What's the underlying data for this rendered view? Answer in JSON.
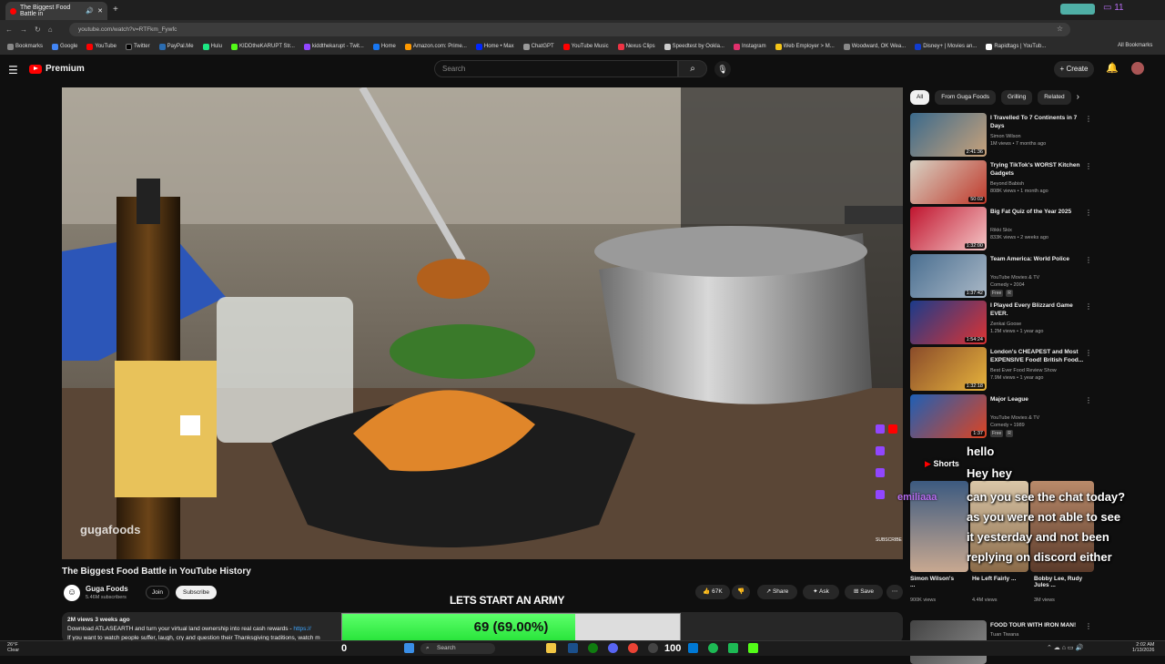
{
  "browser": {
    "tab_title": "The Biggest Food Battle in",
    "url": "youtube.com/watch?v=RTFkm_Fywfc",
    "bookmarks": [
      "Bookmarks",
      "Google",
      "YouTube",
      "Twitter",
      "PayPal.Me",
      "Hulu",
      "KIDDtheKARUPT Str...",
      "kiddthekarupt - Twit...",
      "Home",
      "Amazon.com: Prime...",
      "Home • Max",
      "ChatGPT",
      "YouTube Music",
      "Nexus Clips",
      "Speedtest by Ookla...",
      "Instagram",
      "Web Employer > M...",
      "Woodward, OK Wea...",
      "Disney+ | Movies an...",
      "Rapidtags | YouTub..."
    ],
    "all_bookmarks": "All Bookmarks"
  },
  "header": {
    "logo_label": "Premium",
    "search_placeholder": "Search",
    "create_label": "Create"
  },
  "video": {
    "title": "The Biggest Food Battle in YouTube History",
    "channel": "Guga Foods",
    "subscribers": "5.46M subscribers",
    "join": "Join",
    "subscribe": "Subscribe",
    "likes": "67K",
    "share": "Share",
    "ask": "Ask",
    "save": "Save",
    "watermark": "gugafoods",
    "subscribe_watermark": "SUBSCRIBE",
    "desc_meta": "2M views  3 weeks ago",
    "desc_line1": "Download ATLASEARTH and turn your virtual land ownership into real cash rewards - ",
    "desc_link": "https://",
    "desc_line2": "If you want to watch people suffer, laugh, cry and question their Thanksgiving traditions, watch m"
  },
  "chips": [
    "All",
    "From Guga Foods",
    "Grilling",
    "Related"
  ],
  "recommendations": [
    {
      "title": "I Travelled To 7 Continents in 7 Days",
      "channel": "Simon Wilson",
      "meta": "1M views • 7 months ago",
      "duration": "2:41:36",
      "colors": [
        "#3b6a8c",
        "#c9a27a"
      ]
    },
    {
      "title": "Trying TikTok's WORST Kitchen Gadgets",
      "channel": "Beyond Babish",
      "meta": "808K views • 1 month ago",
      "duration": "50:02",
      "colors": [
        "#d7d2c4",
        "#c0392b"
      ]
    },
    {
      "title": "Big Fat Quiz of the Year 2025",
      "channel": "Rikki Skix",
      "meta": "833K views • 2 weeks ago",
      "duration": "1:32:00",
      "colors": [
        "#c0152f",
        "#f4c6c6"
      ]
    },
    {
      "title": "Team America: World Police",
      "channel": "YouTube Movies & TV",
      "meta": "Comedy • 2004",
      "badges": [
        "Free",
        "R"
      ],
      "duration": "1:37:42",
      "colors": [
        "#4a6f91",
        "#aab8c6"
      ]
    },
    {
      "title": "I Played Every Blizzard Game EVER.",
      "channel": "Zenkai Goose",
      "meta": "1.2M views • 1 year ago",
      "duration": "1:54:24",
      "colors": [
        "#1b3b8a",
        "#d33"
      ]
    },
    {
      "title": "London's CHEAPEST and Most EXPENSIVE Food! British Food...",
      "channel": "Best Ever Food Review Show",
      "meta": "7.9M views • 1 year ago",
      "duration": "1:32:18",
      "colors": [
        "#8a4b2a",
        "#e6b33c"
      ]
    },
    {
      "title": "Major League",
      "channel": "YouTube Movies & TV",
      "meta": "Comedy • 1989",
      "badges": [
        "Free",
        "R"
      ],
      "duration": "1:37",
      "colors": [
        "#1e5fb5",
        "#d42"
      ]
    },
    {
      "title": "FOOD TOUR WITH IRON MAN!",
      "channel": "Tuan Tiwana",
      "meta": "",
      "duration": "",
      "colors": [
        "#444",
        "#888"
      ]
    }
  ],
  "shorts": {
    "label": "Shorts",
    "items": [
      {
        "title": "Simon Wilson's ...",
        "meta": "900K views"
      },
      {
        "title": "He Left Fairly ...",
        "meta": "4.4M views"
      },
      {
        "title": "Bobby Lee, Rudy Jules ...",
        "meta": "3M views"
      }
    ]
  },
  "stream_overlay": {
    "chat_user": "emiliaaa",
    "chat_messages": [
      "hello",
      "Hey hey",
      "can you see the chat today?",
      "as you were not able to see",
      "it yesterday and not been",
      "replying on discord either"
    ],
    "goal_banner": "LETS START AN ARMY",
    "goal_text": "69 (69.00%)",
    "goal_fraction": 0.69,
    "counter_left": "0",
    "counter_right": "100"
  },
  "taskbar": {
    "weather_temp": "26°F",
    "weather_desc": "Clear",
    "search": "Search",
    "time": "2:02 AM",
    "date": "1/13/2026"
  },
  "colors": {
    "accent": "#ff0000",
    "goal_green": "#3ef04e",
    "link": "#3ea6ff"
  }
}
